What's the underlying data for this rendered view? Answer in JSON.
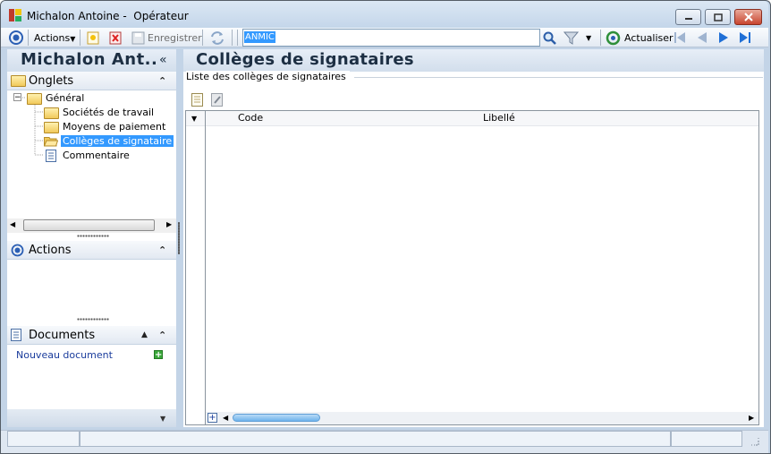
{
  "window": {
    "title": "Michalon Antoine -  Opérateur"
  },
  "toolbar": {
    "actions_label": "Actions",
    "save_label": "Enregistrer",
    "search_value": "ANMIC",
    "refresh_label": "Actualiser"
  },
  "left_panel": {
    "title": "Michalon Ant..",
    "collapse_glyph": "«",
    "onglets": {
      "label": "Onglets",
      "root": "Général",
      "items": [
        {
          "label": "Sociétés de travail",
          "icon": "folder-icon"
        },
        {
          "label": "Moyens de paiement",
          "icon": "folder-icon"
        },
        {
          "label": "Collèges de signataire",
          "icon": "open-folder-icon",
          "selected": true
        },
        {
          "label": "Commentaire",
          "icon": "document-icon"
        }
      ]
    },
    "actions": {
      "label": "Actions"
    },
    "documents": {
      "label": "Documents",
      "new_document": "Nouveau document"
    }
  },
  "main": {
    "title": "Collèges de signataires",
    "group_label": "Liste des collèges de signataires",
    "grid": {
      "columns": [
        "Code",
        "Libellé"
      ],
      "rows": []
    }
  },
  "colors": {
    "accent": "#3399ff",
    "header_text": "#1d2f43",
    "link": "#1a3c9c"
  }
}
